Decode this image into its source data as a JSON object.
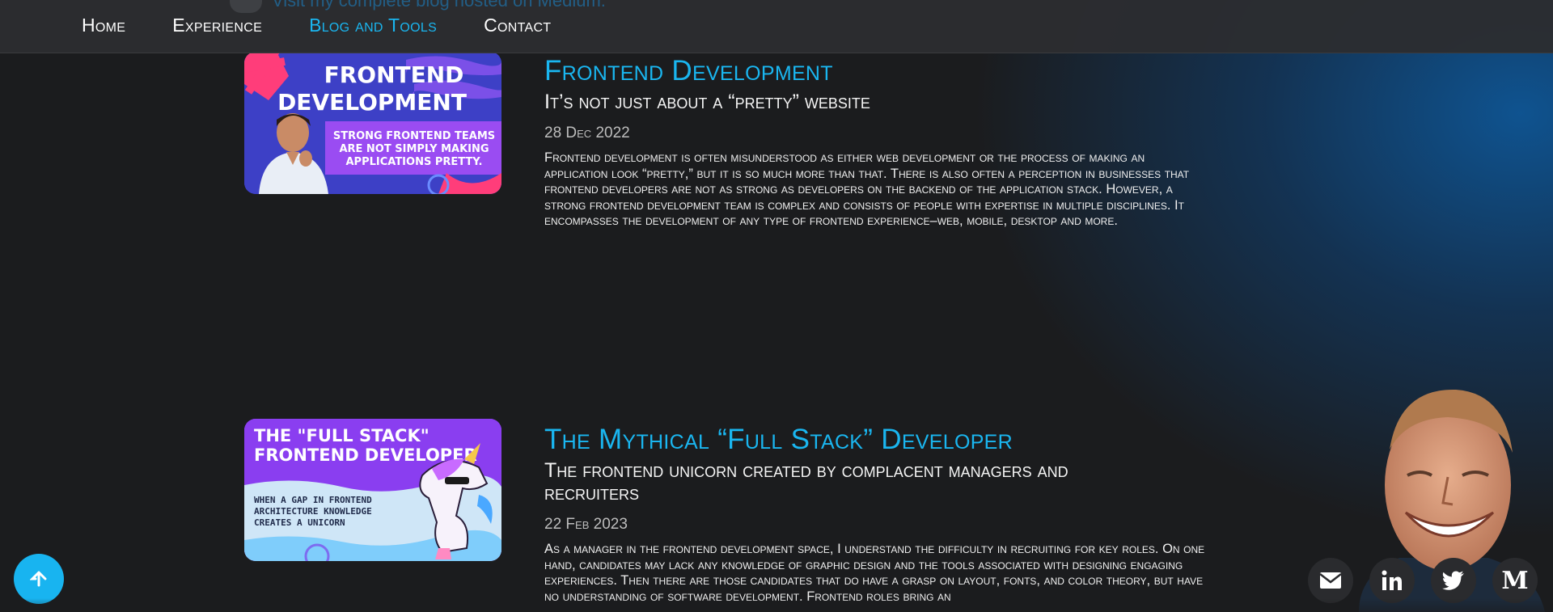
{
  "nav": {
    "ghost_link": "Visit my complete blog hosted on Medium.",
    "items": [
      {
        "label": "Home",
        "active": false
      },
      {
        "label": "Experience",
        "active": false
      },
      {
        "label": "Blog and Tools",
        "active": true
      },
      {
        "label": "Contact",
        "active": false
      }
    ]
  },
  "posts": [
    {
      "title": "Frontend Development",
      "subtitle": "It’s not just about a “pretty” website",
      "date": "28 Dec 2022",
      "body": "Frontend development is often misunderstood as either web development or the process of making an application look “pretty,” but it is so much more than that. There is also often a perception in businesses that frontend developers are not as strong as developers on the backend of the application stack. However, a strong frontend development team is complex and consists of people with expertise in multiple disciplines. It encompasses the development of any type of frontend experience–web, mobile, desktop and more.",
      "thumb": {
        "line1": "FRONTEND",
        "line2": "DEVELOPMENT",
        "tag1": "STRONG FRONTEND TEAMS",
        "tag2": "ARE NOT SIMPLY MAKING",
        "tag3": "APPLICATIONS PRETTY."
      }
    },
    {
      "title": "The Mythical “Full Stack” Developer",
      "subtitle": "The frontend unicorn created by complacent managers and recruiters",
      "date": "22 Feb 2023",
      "body": "As a manager in the frontend development space, I understand the difficulty in recruiting for key roles. On one hand, candidates may lack any knowledge of graphic design and the tools associated with designing engaging experiences. Then there are those candidates that do have a grasp on layout, fonts, and color theory, but have no understanding of software development. Frontend roles bring an",
      "thumb": {
        "line1": "THE \"FULL STACK\"",
        "line2": "FRONTEND DEVELOPER",
        "tag1": "WHEN A GAP IN FRONTEND",
        "tag2": "ARCHITECTURE KNOWLEDGE",
        "tag3": "CREATES A UNICORN"
      }
    }
  ],
  "social": [
    {
      "icon": "envelope-icon"
    },
    {
      "icon": "linkedin-icon"
    },
    {
      "icon": "twitter-icon"
    },
    {
      "icon": "medium-icon",
      "label": "M"
    }
  ],
  "colors": {
    "accent": "#1ab6f0",
    "background": "#1b1c1e",
    "nav_bg": "#2c2d30"
  }
}
